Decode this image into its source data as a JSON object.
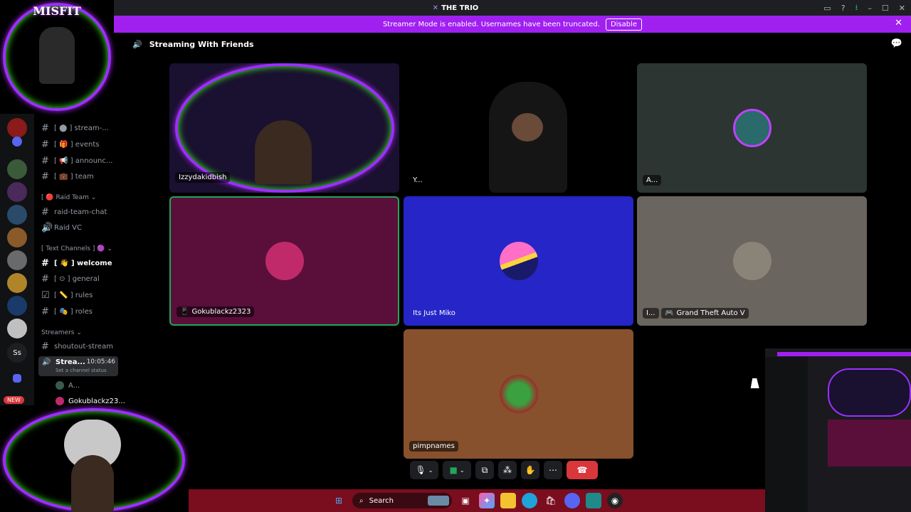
{
  "titlebar": {
    "title": "THE TRIO"
  },
  "banner": {
    "message": "Streamer Mode is enabled. Usernames have been truncated.",
    "disable_label": "Disable"
  },
  "channel_header": {
    "title": "Streaming With Friends"
  },
  "sidebar": {
    "channels_top": [
      {
        "icon": "#",
        "label": "[ ⬤ ] stream-..."
      },
      {
        "icon": "#",
        "label": "[ 🎁 ] events"
      },
      {
        "icon": "#",
        "label": "[ 📢 ] announc..."
      },
      {
        "icon": "#",
        "label": "[ 💼 ] team"
      }
    ],
    "raid_category": "[ 🔴 Raid Team ⌄",
    "raid_channels": [
      {
        "icon": "#",
        "label": "raid-team-chat"
      },
      {
        "icon": "🔊",
        "label": "Raid VC"
      }
    ],
    "text_category": "[ Text Channels ] 🟣 ⌄",
    "text_channels": [
      {
        "icon": "#",
        "label": "[ 👋 ] welcome",
        "selected": true
      },
      {
        "icon": "#",
        "label": "[ ⊙ ] general"
      },
      {
        "icon": "☑",
        "label": "[ 📏 ] rules"
      },
      {
        "icon": "#",
        "label": "[ 🎭 ] roles"
      }
    ],
    "streamers_category": "Streamers ⌄",
    "streamers_channels": [
      {
        "icon": "#",
        "label": "shoutout-stream"
      }
    ],
    "voice_active": {
      "label": "Strea...",
      "time": "10:05:46",
      "status": "Set a channel status"
    },
    "voice_members": [
      "A...",
      "Gokublackz23..."
    ],
    "new_badge": "NEW",
    "server_initials": "Ss"
  },
  "tiles": [
    {
      "name": "Izzydakidbish",
      "bg": "#1a1030"
    },
    {
      "name": "Y...",
      "bg": "#000000"
    },
    {
      "name": "A...",
      "bg": "#2c3532"
    },
    {
      "name": "Gokublackz2323",
      "bg": "#5a0f3a"
    },
    {
      "name": "Its Just Miko",
      "bg": "#2525c8"
    },
    {
      "name": "I...",
      "activity": "Grand Theft Auto V",
      "bg": "#6b655f"
    },
    {
      "name": "pimpnames",
      "bg": "#87512d"
    }
  ],
  "taskbar": {
    "search_label": "Search"
  },
  "overlay": {
    "brand": "MISFIT"
  },
  "colors": {
    "banner": "#a020f0",
    "taskbar": "#7a0d1e",
    "end_call": "#da373c",
    "speaking": "#23a55a"
  }
}
